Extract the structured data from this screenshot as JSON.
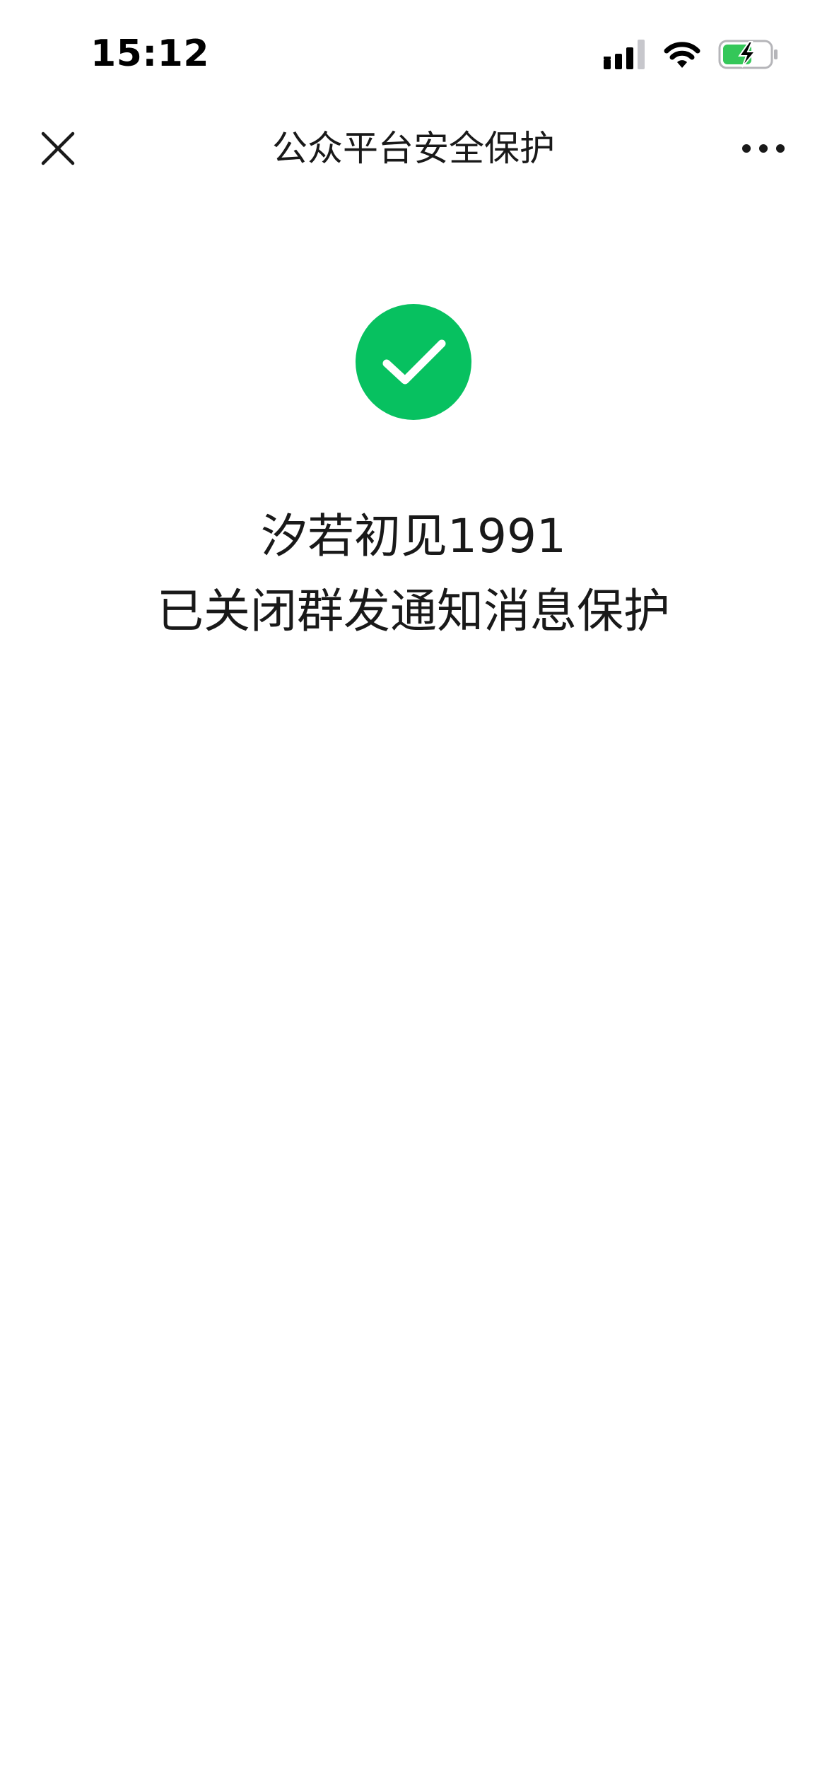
{
  "status_bar": {
    "time": "15:12",
    "icons": [
      "cellular-signal-icon",
      "wifi-icon",
      "battery-charging-icon"
    ],
    "battery_color": "#34c759"
  },
  "nav": {
    "title": "公众平台安全保护",
    "close_icon": "close-icon",
    "more_icon": "more-options-icon"
  },
  "result": {
    "icon": "check-circle-icon",
    "icon_color": "#07c160",
    "account_name": "汐若初见1991",
    "message": "已关闭群发通知消息保护"
  }
}
